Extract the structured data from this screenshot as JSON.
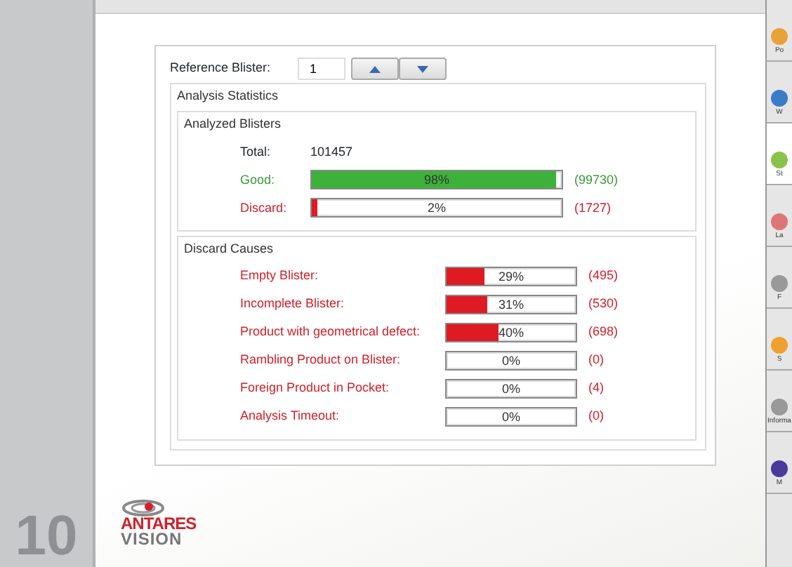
{
  "page_number": "10",
  "reference": {
    "label": "Reference Blister:",
    "value": "1"
  },
  "statistics": {
    "title": "Analysis Statistics",
    "analyzed": {
      "title": "Analyzed Blisters",
      "total_label": "Total:",
      "total": "101457",
      "rows": [
        {
          "label": "Good:",
          "kind": "good",
          "level": 0.98,
          "reading": "98%",
          "count": "(99730)"
        },
        {
          "label": "Discard:",
          "kind": "discard",
          "level": 0.02,
          "reading": "2%",
          "count": "(1727)"
        }
      ]
    },
    "causes": {
      "title": "Discard Causes",
      "rows": [
        {
          "label": "Empty Blister:",
          "level": 0.29,
          "reading": "29%",
          "count": "(495)"
        },
        {
          "label": "Incomplete Blister:",
          "level": 0.31,
          "reading": "31%",
          "count": "(530)"
        },
        {
          "label": "Product with geometrical defect:",
          "level": 0.4,
          "reading": "40%",
          "count": "(698)"
        },
        {
          "label": "Rambling Product on Blister:",
          "level": 0,
          "reading": "0%",
          "count": "(0)"
        },
        {
          "label": "Foreign Product in Pocket:",
          "level": 0,
          "reading": "0%",
          "count": "(4)"
        },
        {
          "label": "Analysis Timeout:",
          "level": 0,
          "reading": "0%",
          "count": "(0)"
        }
      ]
    }
  },
  "logo": {
    "line1": "ANTARES",
    "line2": "VISION"
  },
  "sidebar": {
    "items": [
      {
        "label": "Po",
        "selected": false
      },
      {
        "label": "W",
        "selected": false
      },
      {
        "label": "St",
        "selected": true
      },
      {
        "label": "La",
        "selected": false
      },
      {
        "label": "F",
        "selected": false
      },
      {
        "label": "S",
        "selected": false
      },
      {
        "label": "Informa",
        "selected": false
      },
      {
        "label": "M",
        "selected": false
      }
    ]
  }
}
